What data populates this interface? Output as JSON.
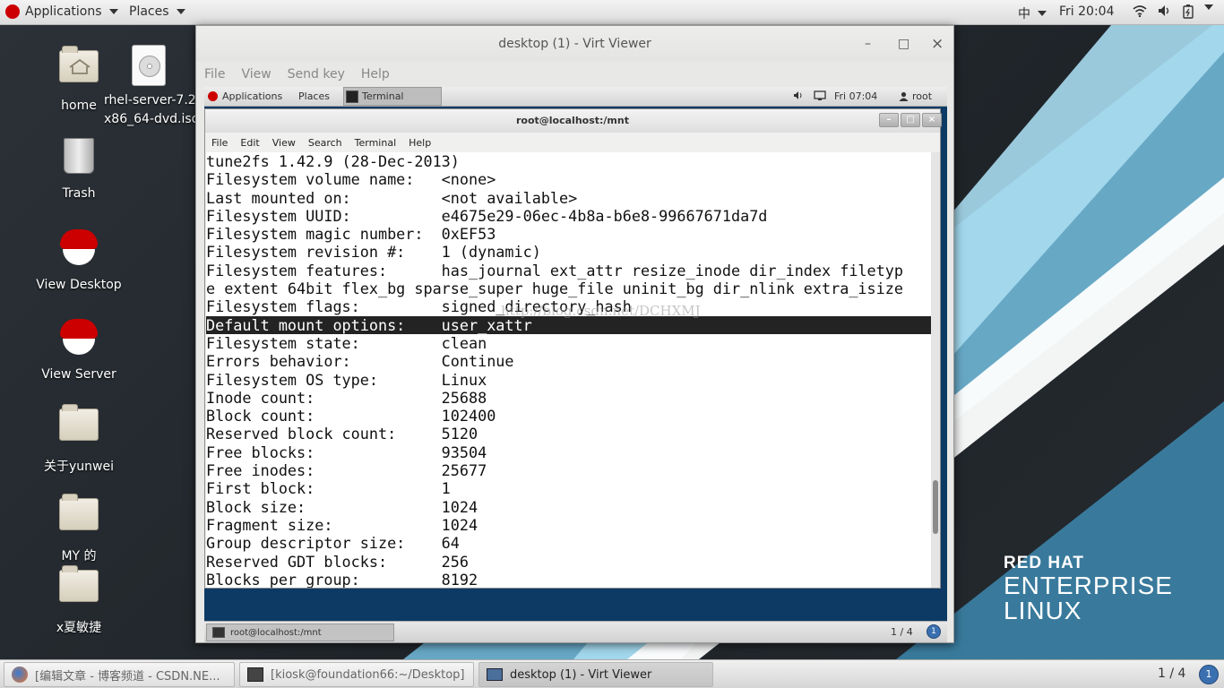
{
  "topbar": {
    "applications": "Applications",
    "places": "Places",
    "input_method": "中",
    "clock": "Fri 20:04"
  },
  "desktop_icons": [
    {
      "label": "home"
    },
    {
      "label": "rhel-server-7.2-\nx86_64-dvd.iso"
    },
    {
      "label": "Trash"
    },
    {
      "label": "View Desktop"
    },
    {
      "label": "View Server"
    },
    {
      "label": "关于yunwei"
    },
    {
      "label": "MY 的"
    },
    {
      "label": "x夏敏捷"
    }
  ],
  "virt_viewer": {
    "title": "desktop (1) - Virt Viewer",
    "menu": [
      "File",
      "View",
      "Send key",
      "Help"
    ],
    "minimize": "–",
    "maximize": "□",
    "close": "×"
  },
  "guest_topbar": {
    "applications": "Applications",
    "places": "Places",
    "task": "Terminal",
    "clock": "Fri 07:04",
    "user": "root"
  },
  "terminal": {
    "title": "root@localhost:/mnt",
    "menu": [
      "File",
      "Edit",
      "View",
      "Search",
      "Terminal",
      "Help"
    ],
    "lines": [
      "tune2fs 1.42.9 (28-Dec-2013)",
      "Filesystem volume name:   <none>",
      "Last mounted on:          <not available>",
      "Filesystem UUID:          e4675e29-06ec-4b8a-b6e8-99667671da7d",
      "Filesystem magic number:  0xEF53",
      "Filesystem revision #:    1 (dynamic)",
      "Filesystem features:      has_journal ext_attr resize_inode dir_index filetyp",
      "e extent 64bit flex_bg sparse_super huge_file uninit_bg dir_nlink extra_isize",
      "Filesystem flags:         signed_directory_hash",
      "Default mount options:    user_xattr",
      "Filesystem state:         clean",
      "Errors behavior:          Continue",
      "Filesystem OS type:       Linux",
      "Inode count:              25688",
      "Block count:              102400",
      "Reserved block count:     5120",
      "Free blocks:              93504",
      "Free inodes:              25677",
      "First block:              1",
      "Block size:               1024",
      "Fragment size:            1024",
      "Group descriptor size:    64",
      "Reserved GDT blocks:      256",
      "Blocks per group:         8192"
    ],
    "highlight_index": 9,
    "watermark": "http://blog.csdn.net/DCHXMJ"
  },
  "guest_bottom": {
    "task": "root@localhost:/mnt",
    "workspace": "1 / 4"
  },
  "taskbar": {
    "tasks": [
      "[编辑文章 - 博客频道 - CSDN.NE...",
      "[kiosk@foundation66:~/Desktop]",
      "desktop (1) - Virt Viewer"
    ],
    "workspace": "1 / 4"
  },
  "branding": {
    "line1": "RED HAT",
    "line2": "ENTERPRISE",
    "line3": "LINUX"
  }
}
